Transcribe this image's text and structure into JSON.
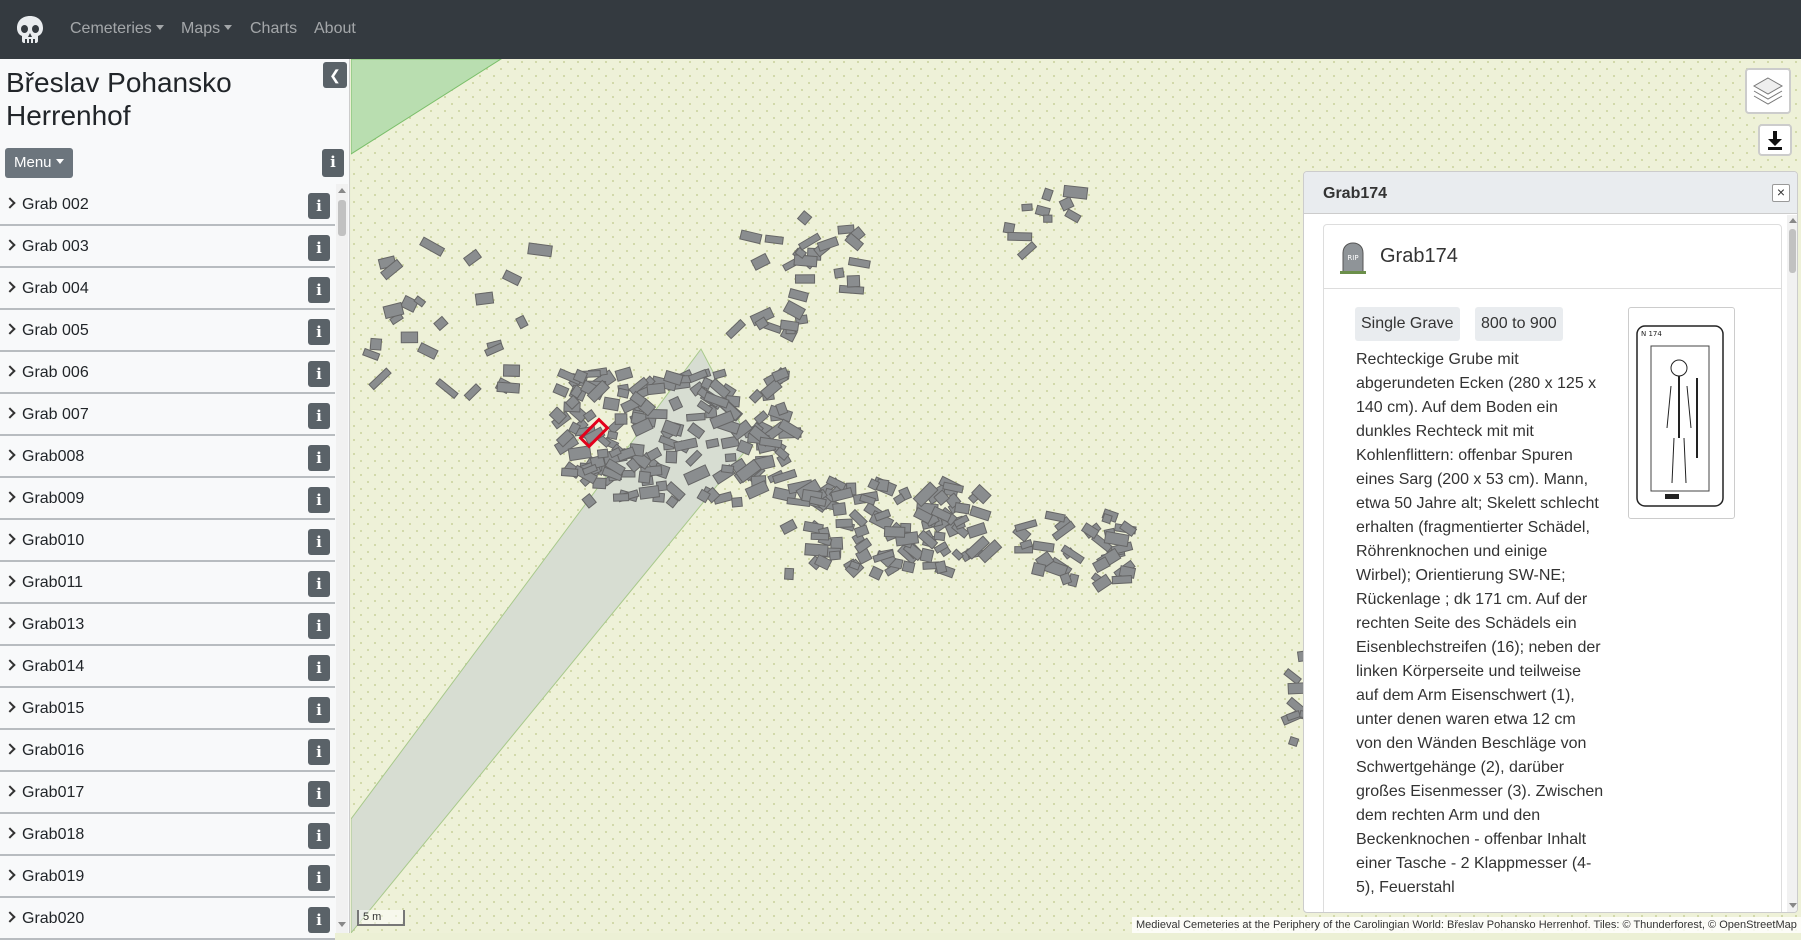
{
  "nav": {
    "items": [
      {
        "label": "Cemeteries",
        "dropdown": true
      },
      {
        "label": "Maps",
        "dropdown": true
      },
      {
        "label": "Charts",
        "dropdown": false
      },
      {
        "label": "About",
        "dropdown": false
      }
    ]
  },
  "sidebar": {
    "title": "Břeslav Pohansko Herrenhof",
    "menu_label": "Menu",
    "graves": [
      "Grab 002",
      "Grab 003",
      "Grab 004",
      "Grab 005",
      "Grab 006",
      "Grab 007",
      "Grab008",
      "Grab009",
      "Grab010",
      "Grab011",
      "Grab013",
      "Grab014",
      "Grab015",
      "Grab016",
      "Grab017",
      "Grab018",
      "Grab019",
      "Grab020"
    ]
  },
  "map": {
    "scale_label": "5 m",
    "attribution": "Medieval Cemeteries at the Periphery of the Carolingian World: Břeslav Pohansko Herrenhof. Tiles: © Thunderforest, © OpenStreetMap",
    "selected_color": "#e3001b",
    "grave_color": "#8a8d8f"
  },
  "popup": {
    "header": "Grab174",
    "name": "Grab174",
    "type_badge": "Single Grave",
    "date_badge": "800 to 900",
    "description": "Rechteckige Grube mit abgerundeten Ecken (280 x 125 x 140 cm). Auf dem Boden ein dunkles Rechteck mit mit Kohlenflittern: offenbar Spuren eines Sarg (200 x 53 cm). Mann, etwa 50 Jahre alt; Skelett schlecht erhalten (fragmentierter Schädel, Röhrenknochen und einige Wirbel); Orientierung SW-NE; Rückenlage ; dk 171 cm. Auf der rechten Seite des Schädels ein Eisenblechstreifen (16); neben der linken Körperseite und teilweise auf dem Arm Eisenschwert (1), unter denen waren etwa 12 cm von den Wänden Beschläge von Schwertgehänge (2), darüber großes Eisenmesser (3). Zwischen dem rechten Arm und den Beckenknochen - offenbar Inhalt einer Tasche - 2 Klappmesser (4-5), Feuerstahl",
    "image_caption": "N 174"
  },
  "icons": {
    "logo": "skull-icon",
    "collapse": "chevron-left-icon",
    "info": "info-icon",
    "layers": "layers-icon",
    "download": "download-icon",
    "tombstone": "tombstone-icon",
    "close": "close-icon"
  }
}
